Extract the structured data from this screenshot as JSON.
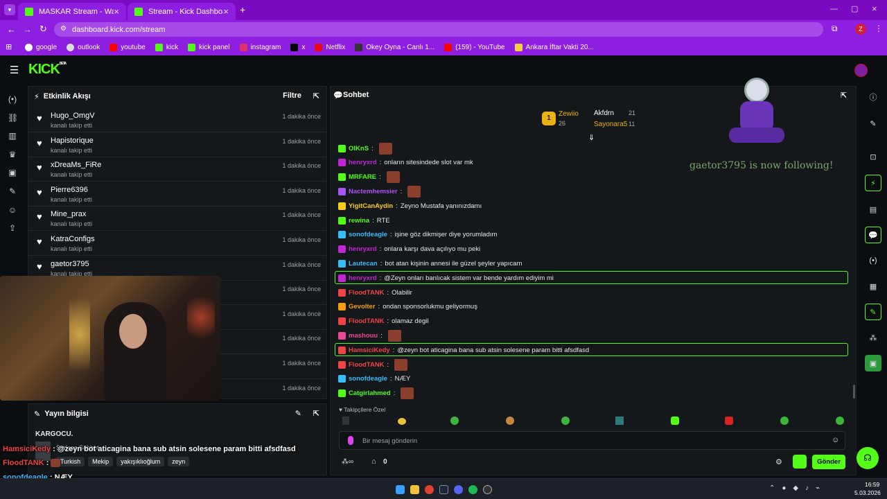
{
  "browser": {
    "tabs": [
      {
        "title": "MASKAR Stream - Watch Live o",
        "active": false
      },
      {
        "title": "Stream - Kick Dashboard",
        "active": true
      }
    ],
    "url": "dashboard.kick.com/stream",
    "profile_initial": "Z",
    "bookmarks": [
      "google",
      "outlook",
      "youtube",
      "kick",
      "kick panel",
      "instagram",
      "x",
      "Netflix",
      "Okey Oyna - Canlı 1...",
      "(159) - YouTube",
      "Ankara İftar Vakti 20..."
    ]
  },
  "kick": {
    "logo": "KICK",
    "logo_beta": "BETA"
  },
  "activity": {
    "title": "Etkinlik Akışı",
    "filter_label": "Filtre",
    "items": [
      {
        "name": "Hugo_OmgV",
        "action": "kanalı takip etti",
        "time": "1 dakika önce"
      },
      {
        "name": "Hapistorique",
        "action": "kanalı takip etti",
        "time": "1 dakika önce"
      },
      {
        "name": "xDreaMs_FiRe",
        "action": "kanalı takip etti",
        "time": "1 dakika önce"
      },
      {
        "name": "Pierre6396",
        "action": "kanalı takip etti",
        "time": "1 dakika önce"
      },
      {
        "name": "Mine_prax",
        "action": "kanalı takip etti",
        "time": "1 dakika önce"
      },
      {
        "name": "KatraConfigs",
        "action": "kanalı takip etti",
        "time": "1 dakika önce"
      },
      {
        "name": "gaetor3795",
        "action": "kanalı takip etti",
        "time": "1 dakika önce"
      },
      {
        "name": "",
        "action": "",
        "time": "1 dakika önce"
      },
      {
        "name": "",
        "action": "",
        "time": "1 dakika önce"
      },
      {
        "name": "",
        "action": "",
        "time": "1 dakika önce"
      },
      {
        "name": "",
        "action": "",
        "time": "1 dakika önce"
      },
      {
        "name": "",
        "action": "",
        "time": "1 dakika önce"
      }
    ]
  },
  "stream_info": {
    "title": "Yayın bilgisi",
    "stream_title": "KARGOCU.",
    "category": "Sadece Sohbet",
    "tags": [
      "Turkish",
      "Mekip",
      "yakışıklıoğlum",
      "zeyn"
    ]
  },
  "chat": {
    "title": "Sohbet",
    "leaderboard": [
      {
        "rank": "1",
        "name": "Zewiio",
        "count": "26"
      },
      {
        "name": "Akfdrn",
        "count": "21"
      },
      {
        "name": "Sayonara5",
        "count": "11"
      }
    ],
    "follow_alert": "gaetor3795 is now following!",
    "messages": [
      {
        "user": "OIKnS",
        "color": "#53fc18",
        "text": "",
        "emote": true
      },
      {
        "user": "henryxrd",
        "color": "#c026d3",
        "text": "onların sitesindede slot var mk"
      },
      {
        "user": "MRFARE",
        "color": "#53fc18",
        "text": "",
        "emote": true
      },
      {
        "user": "Nactemhemsier",
        "color": "#a855f7",
        "text": "",
        "emote": true
      },
      {
        "user": "YigitCanAydin",
        "color": "#facc15",
        "text": "Zeyno Mustafa yanınızdamı"
      },
      {
        "user": "rewina",
        "color": "#53fc18",
        "text": "RTE"
      },
      {
        "user": "sonofdeagle",
        "color": "#38bdf8",
        "text": "işine göz dikmişer diye yorumladım"
      },
      {
        "user": "henryxrd",
        "color": "#c026d3",
        "text": "onlara karşı dava açılıyo mu peki"
      },
      {
        "user": "Lautecan",
        "color": "#38bdf8",
        "text": "bot atan kişinin annesi ile güzel şeyler yapıcam"
      },
      {
        "user": "henryxrd",
        "color": "#c026d3",
        "text": "@Zeyn onları banlıcak sistem var bende yardım ediyim mi",
        "highlight": true
      },
      {
        "user": "FloodTANK",
        "color": "#ef4444",
        "text": "Olabilir"
      },
      {
        "user": "Gevolter",
        "color": "#f59e0b",
        "text": "ondan sponsorlukmu geliyormuş"
      },
      {
        "user": "FloodTANK",
        "color": "#ef4444",
        "text": "olamaz degil"
      },
      {
        "user": "mashouu",
        "color": "#ec4899",
        "text": "",
        "emote": true
      },
      {
        "user": "HamsiciKedy",
        "color": "#ef4444",
        "text": "@zeyn bot aticagina bana sub atsin solesene param bitti afsdfasd",
        "highlight": true
      },
      {
        "user": "FloodTANK",
        "color": "#ef4444",
        "text": "",
        "emote": true
      },
      {
        "user": "sonofdeagle",
        "color": "#38bdf8",
        "text": "NÆY"
      },
      {
        "user": "Catgirlahmed",
        "color": "#53fc18",
        "text": "",
        "emote": true
      }
    ],
    "followers_only_label": "Takipçilere Özel",
    "input_placeholder": "Bir mesaj gönderin",
    "points": "0",
    "send_label": "Gönder"
  },
  "overlay_chat": [
    {
      "user": "HamsiciKedy",
      "color": "#ef4444",
      "text": "@zeyn bot aticagina bana sub atsin solesene param bitti afsdfasd"
    },
    {
      "user": "FloodTANK",
      "color": "#ef4444",
      "text": ""
    },
    {
      "user": "sonofdeagle",
      "color": "#38bdf8",
      "text": "NÆY"
    },
    {
      "user": "Catgirlahmed",
      "color": "#a855f7",
      "text": ""
    }
  ],
  "taskbar": {
    "time": "16:59",
    "date": "5.03.2026"
  },
  "colors": {
    "accent": "#53fc18",
    "chrome": "#7a0bc0"
  }
}
